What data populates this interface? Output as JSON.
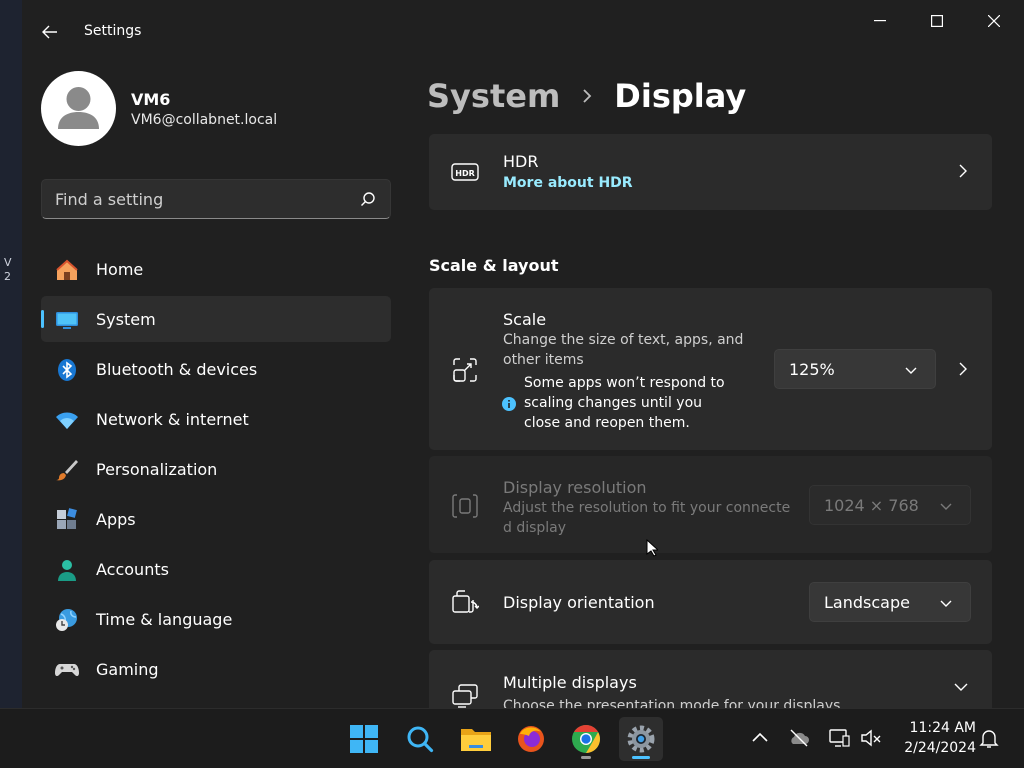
{
  "window": {
    "title": "Settings"
  },
  "desktop_edge": {
    "text_line1": "V",
    "text_line2": "2"
  },
  "account": {
    "name": "VM6",
    "email": "VM6@collabnet.local"
  },
  "search": {
    "placeholder": "Find a setting"
  },
  "nav": {
    "items": [
      {
        "label": "Home",
        "icon": "home-icon",
        "selected": false
      },
      {
        "label": "System",
        "icon": "system-icon",
        "selected": true
      },
      {
        "label": "Bluetooth & devices",
        "icon": "bluetooth-icon",
        "selected": false
      },
      {
        "label": "Network & internet",
        "icon": "wifi-icon",
        "selected": false
      },
      {
        "label": "Personalization",
        "icon": "brush-icon",
        "selected": false
      },
      {
        "label": "Apps",
        "icon": "apps-icon",
        "selected": false
      },
      {
        "label": "Accounts",
        "icon": "accounts-icon",
        "selected": false
      },
      {
        "label": "Time & language",
        "icon": "time-language-icon",
        "selected": false
      },
      {
        "label": "Gaming",
        "icon": "gaming-icon",
        "selected": false
      }
    ]
  },
  "breadcrumb": {
    "parent": "System",
    "current": "Display"
  },
  "hdr": {
    "title": "HDR",
    "link": "More about HDR"
  },
  "scale_layout": {
    "heading": "Scale & layout",
    "scale": {
      "title": "Scale",
      "subtitle_line1": "Change the size of text, apps, and",
      "subtitle_line2": "other items",
      "note_line1": "Some apps won’t respond to",
      "note_line2": "scaling changes until you",
      "note_line3": "close and reopen them.",
      "value": "125%"
    },
    "resolution": {
      "title": "Display resolution",
      "subtitle_line1": "Adjust the resolution to fit your connecte",
      "subtitle_line2": "d display",
      "value": "1024 × 768"
    },
    "orientation": {
      "title": "Display orientation",
      "value": "Landscape"
    },
    "multiple": {
      "title": "Multiple displays",
      "subtitle": "Choose the presentation mode for your displays"
    }
  },
  "taskbar": {
    "apps": [
      "start-icon",
      "search-icon",
      "file-explorer-icon",
      "firefox-icon",
      "chrome-icon",
      "settings-icon"
    ],
    "clock": {
      "time": "11:24 AM",
      "date": "2/24/2024"
    }
  },
  "colors": {
    "accent": "#4cc2ff",
    "background": "#202020",
    "card": "#2b2b2b",
    "link": "#99ebff"
  }
}
